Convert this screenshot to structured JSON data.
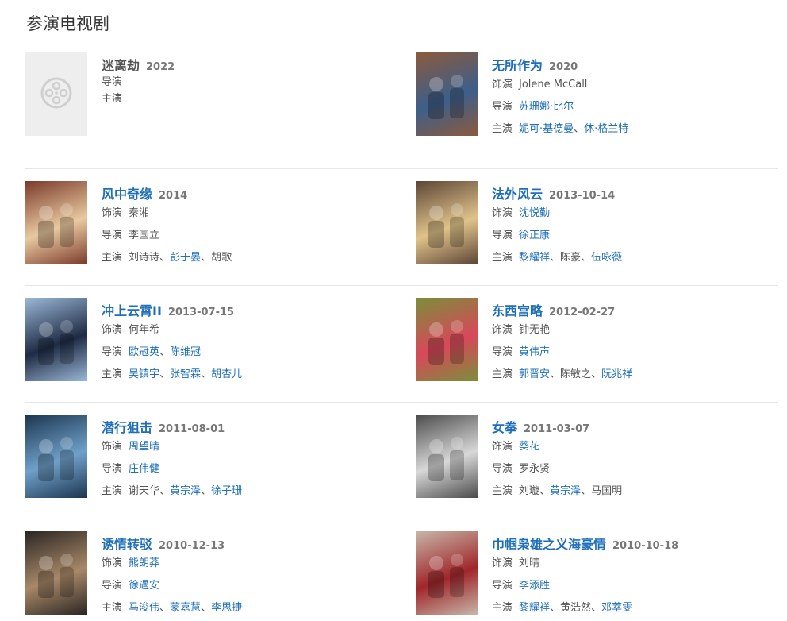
{
  "section": {
    "title": "参演电视剧"
  },
  "labels": {
    "role": "饰演",
    "director": "导演",
    "starring": "主演",
    "sep": "、"
  },
  "items": [
    {
      "title": "迷离劫",
      "date": "2022",
      "title_link": false,
      "role": [],
      "director": [],
      "starring": []
    },
    {
      "title": "无所作为",
      "date": "2020",
      "title_link": true,
      "role": [
        {
          "text": "Jolene McCall",
          "link": false
        }
      ],
      "director": [
        {
          "text": "苏珊娜·比尔",
          "link": true
        }
      ],
      "starring": [
        {
          "text": "妮可·基德曼",
          "link": true
        },
        {
          "text": "休·格兰特",
          "link": true
        }
      ]
    },
    {
      "title": "风中奇缘",
      "date": "2014",
      "title_link": true,
      "role": [
        {
          "text": "秦湘",
          "link": false
        }
      ],
      "director": [
        {
          "text": "李国立",
          "link": false
        }
      ],
      "starring": [
        {
          "text": "刘诗诗",
          "link": false
        },
        {
          "text": "彭于晏",
          "link": true
        },
        {
          "text": "胡歌",
          "link": false
        }
      ]
    },
    {
      "title": "法外风云",
      "date": "2013-10-14",
      "title_link": true,
      "role": [
        {
          "text": "沈悦勤",
          "link": true
        }
      ],
      "director": [
        {
          "text": "徐正康",
          "link": true
        }
      ],
      "starring": [
        {
          "text": "黎耀祥",
          "link": true
        },
        {
          "text": "陈豪",
          "link": false
        },
        {
          "text": "伍咏薇",
          "link": true
        }
      ]
    },
    {
      "title": "冲上云霄II",
      "date": "2013-07-15",
      "title_link": true,
      "role": [
        {
          "text": "何年希",
          "link": false
        }
      ],
      "director": [
        {
          "text": "欧冠英",
          "link": true
        },
        {
          "text": "陈维冠",
          "link": true
        }
      ],
      "starring": [
        {
          "text": "吴镇宇",
          "link": true
        },
        {
          "text": "张智霖",
          "link": true
        },
        {
          "text": "胡杏儿",
          "link": true
        }
      ]
    },
    {
      "title": "东西宫略",
      "date": "2012-02-27",
      "title_link": true,
      "role": [
        {
          "text": "钟无艳",
          "link": false
        }
      ],
      "director": [
        {
          "text": "黄伟声",
          "link": true
        }
      ],
      "starring": [
        {
          "text": "郭晋安",
          "link": true
        },
        {
          "text": "陈敏之",
          "link": false
        },
        {
          "text": "阮兆祥",
          "link": true
        }
      ]
    },
    {
      "title": "潜行狙击",
      "date": "2011-08-01",
      "title_link": true,
      "role": [
        {
          "text": "周望晴",
          "link": true
        }
      ],
      "director": [
        {
          "text": "庄伟健",
          "link": true
        }
      ],
      "starring": [
        {
          "text": "谢天华",
          "link": false
        },
        {
          "text": "黄宗泽",
          "link": true
        },
        {
          "text": "徐子珊",
          "link": true
        }
      ]
    },
    {
      "title": "女拳",
      "date": "2011-03-07",
      "title_link": true,
      "role": [
        {
          "text": "葵花",
          "link": true
        }
      ],
      "director": [
        {
          "text": "罗永贤",
          "link": false
        }
      ],
      "starring": [
        {
          "text": "刘璇",
          "link": false
        },
        {
          "text": "黄宗泽",
          "link": true
        },
        {
          "text": "马国明",
          "link": false
        }
      ]
    },
    {
      "title": "诱情转驳",
      "date": "2010-12-13",
      "title_link": true,
      "role": [
        {
          "text": "熊朗莽",
          "link": true
        }
      ],
      "director": [
        {
          "text": "徐遇安",
          "link": true
        }
      ],
      "starring": [
        {
          "text": "马浚伟",
          "link": true
        },
        {
          "text": "蒙嘉慧",
          "link": true
        },
        {
          "text": "李思捷",
          "link": true
        }
      ]
    },
    {
      "title": "巾帼枭雄之义海豪情",
      "date": "2010-10-18",
      "title_link": true,
      "role": [
        {
          "text": "刘晴",
          "link": false
        }
      ],
      "director": [
        {
          "text": "李添胜",
          "link": true
        }
      ],
      "starring": [
        {
          "text": "黎耀祥",
          "link": true
        },
        {
          "text": "黄浩然",
          "link": false
        },
        {
          "text": "邓萃雯",
          "link": true
        }
      ]
    }
  ],
  "posters": [
    {
      "icon": "film-reel-icon",
      "bg": "#eeeeee"
    },
    {
      "icon": "poster",
      "bg": "#8c5a3c",
      "accent": "#3c5f8a"
    },
    {
      "icon": "poster",
      "bg": "#7a3a2a",
      "accent": "#e8c9a0"
    },
    {
      "icon": "poster",
      "bg": "#5c4535",
      "accent": "#e0c38a"
    },
    {
      "icon": "poster",
      "bg": "#9bb8d8",
      "accent": "#1f2b44"
    },
    {
      "icon": "poster",
      "bg": "#7a8f3a",
      "accent": "#d8485a"
    },
    {
      "icon": "poster",
      "bg": "#1c3550",
      "accent": "#6fa0c8"
    },
    {
      "icon": "poster",
      "bg": "#4b4b4b",
      "accent": "#d8d8d8"
    },
    {
      "icon": "poster",
      "bg": "#2a2623",
      "accent": "#a88868"
    },
    {
      "icon": "poster",
      "bg": "#c7b6a8",
      "accent": "#a0262a"
    }
  ]
}
